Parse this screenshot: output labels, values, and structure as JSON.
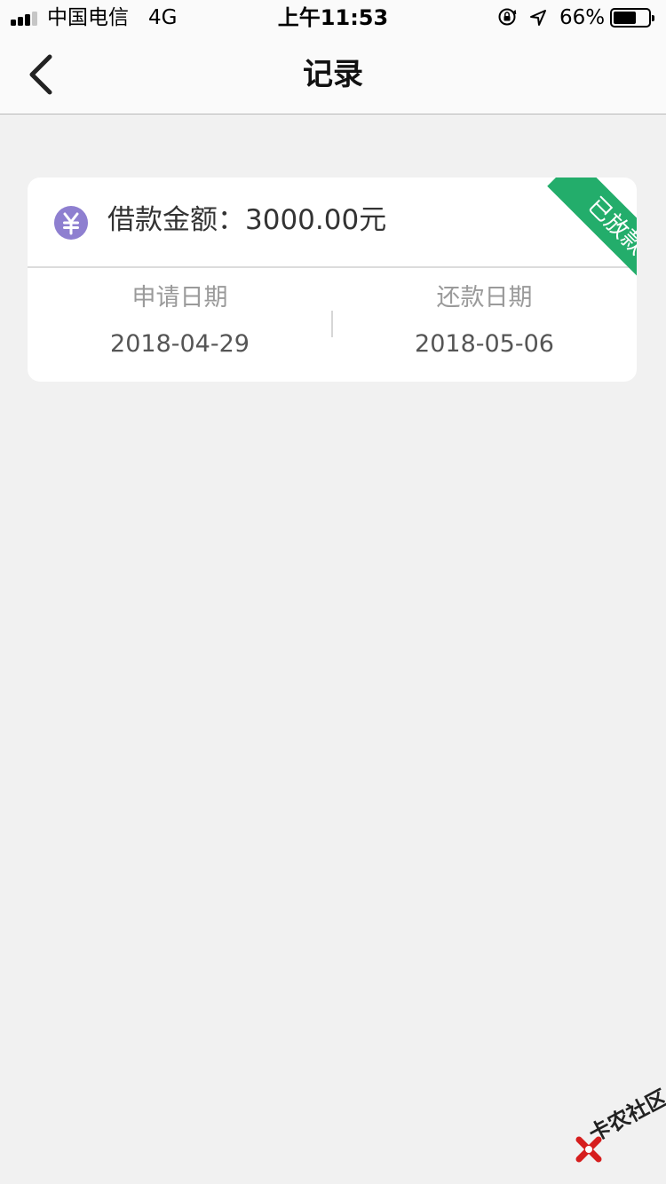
{
  "status_bar": {
    "carrier": "中国电信",
    "network": "4G",
    "time": "上午11:53",
    "battery_percent_text": "66%",
    "battery_level": 0.66,
    "signal_bars_filled": 3,
    "signal_bars_total": 4,
    "icons": [
      "signal-icon",
      "orientation-lock-icon",
      "location-arrow-icon",
      "battery-icon"
    ]
  },
  "nav": {
    "title": "记录",
    "back_icon": "chevron-left-icon"
  },
  "record": {
    "amount_label": "借款金额：",
    "amount_value": "3000.00元",
    "currency_icon": "yuan-icon",
    "currency_symbol": "¥",
    "status": "已放款",
    "status_color": "#23ad6b",
    "icon_color": "#8e7fd0",
    "apply_label": "申请日期",
    "apply_date": "2018-04-29",
    "repay_label": "还款日期",
    "repay_date": "2018-05-06"
  },
  "watermark": {
    "text": "卡农社区"
  }
}
